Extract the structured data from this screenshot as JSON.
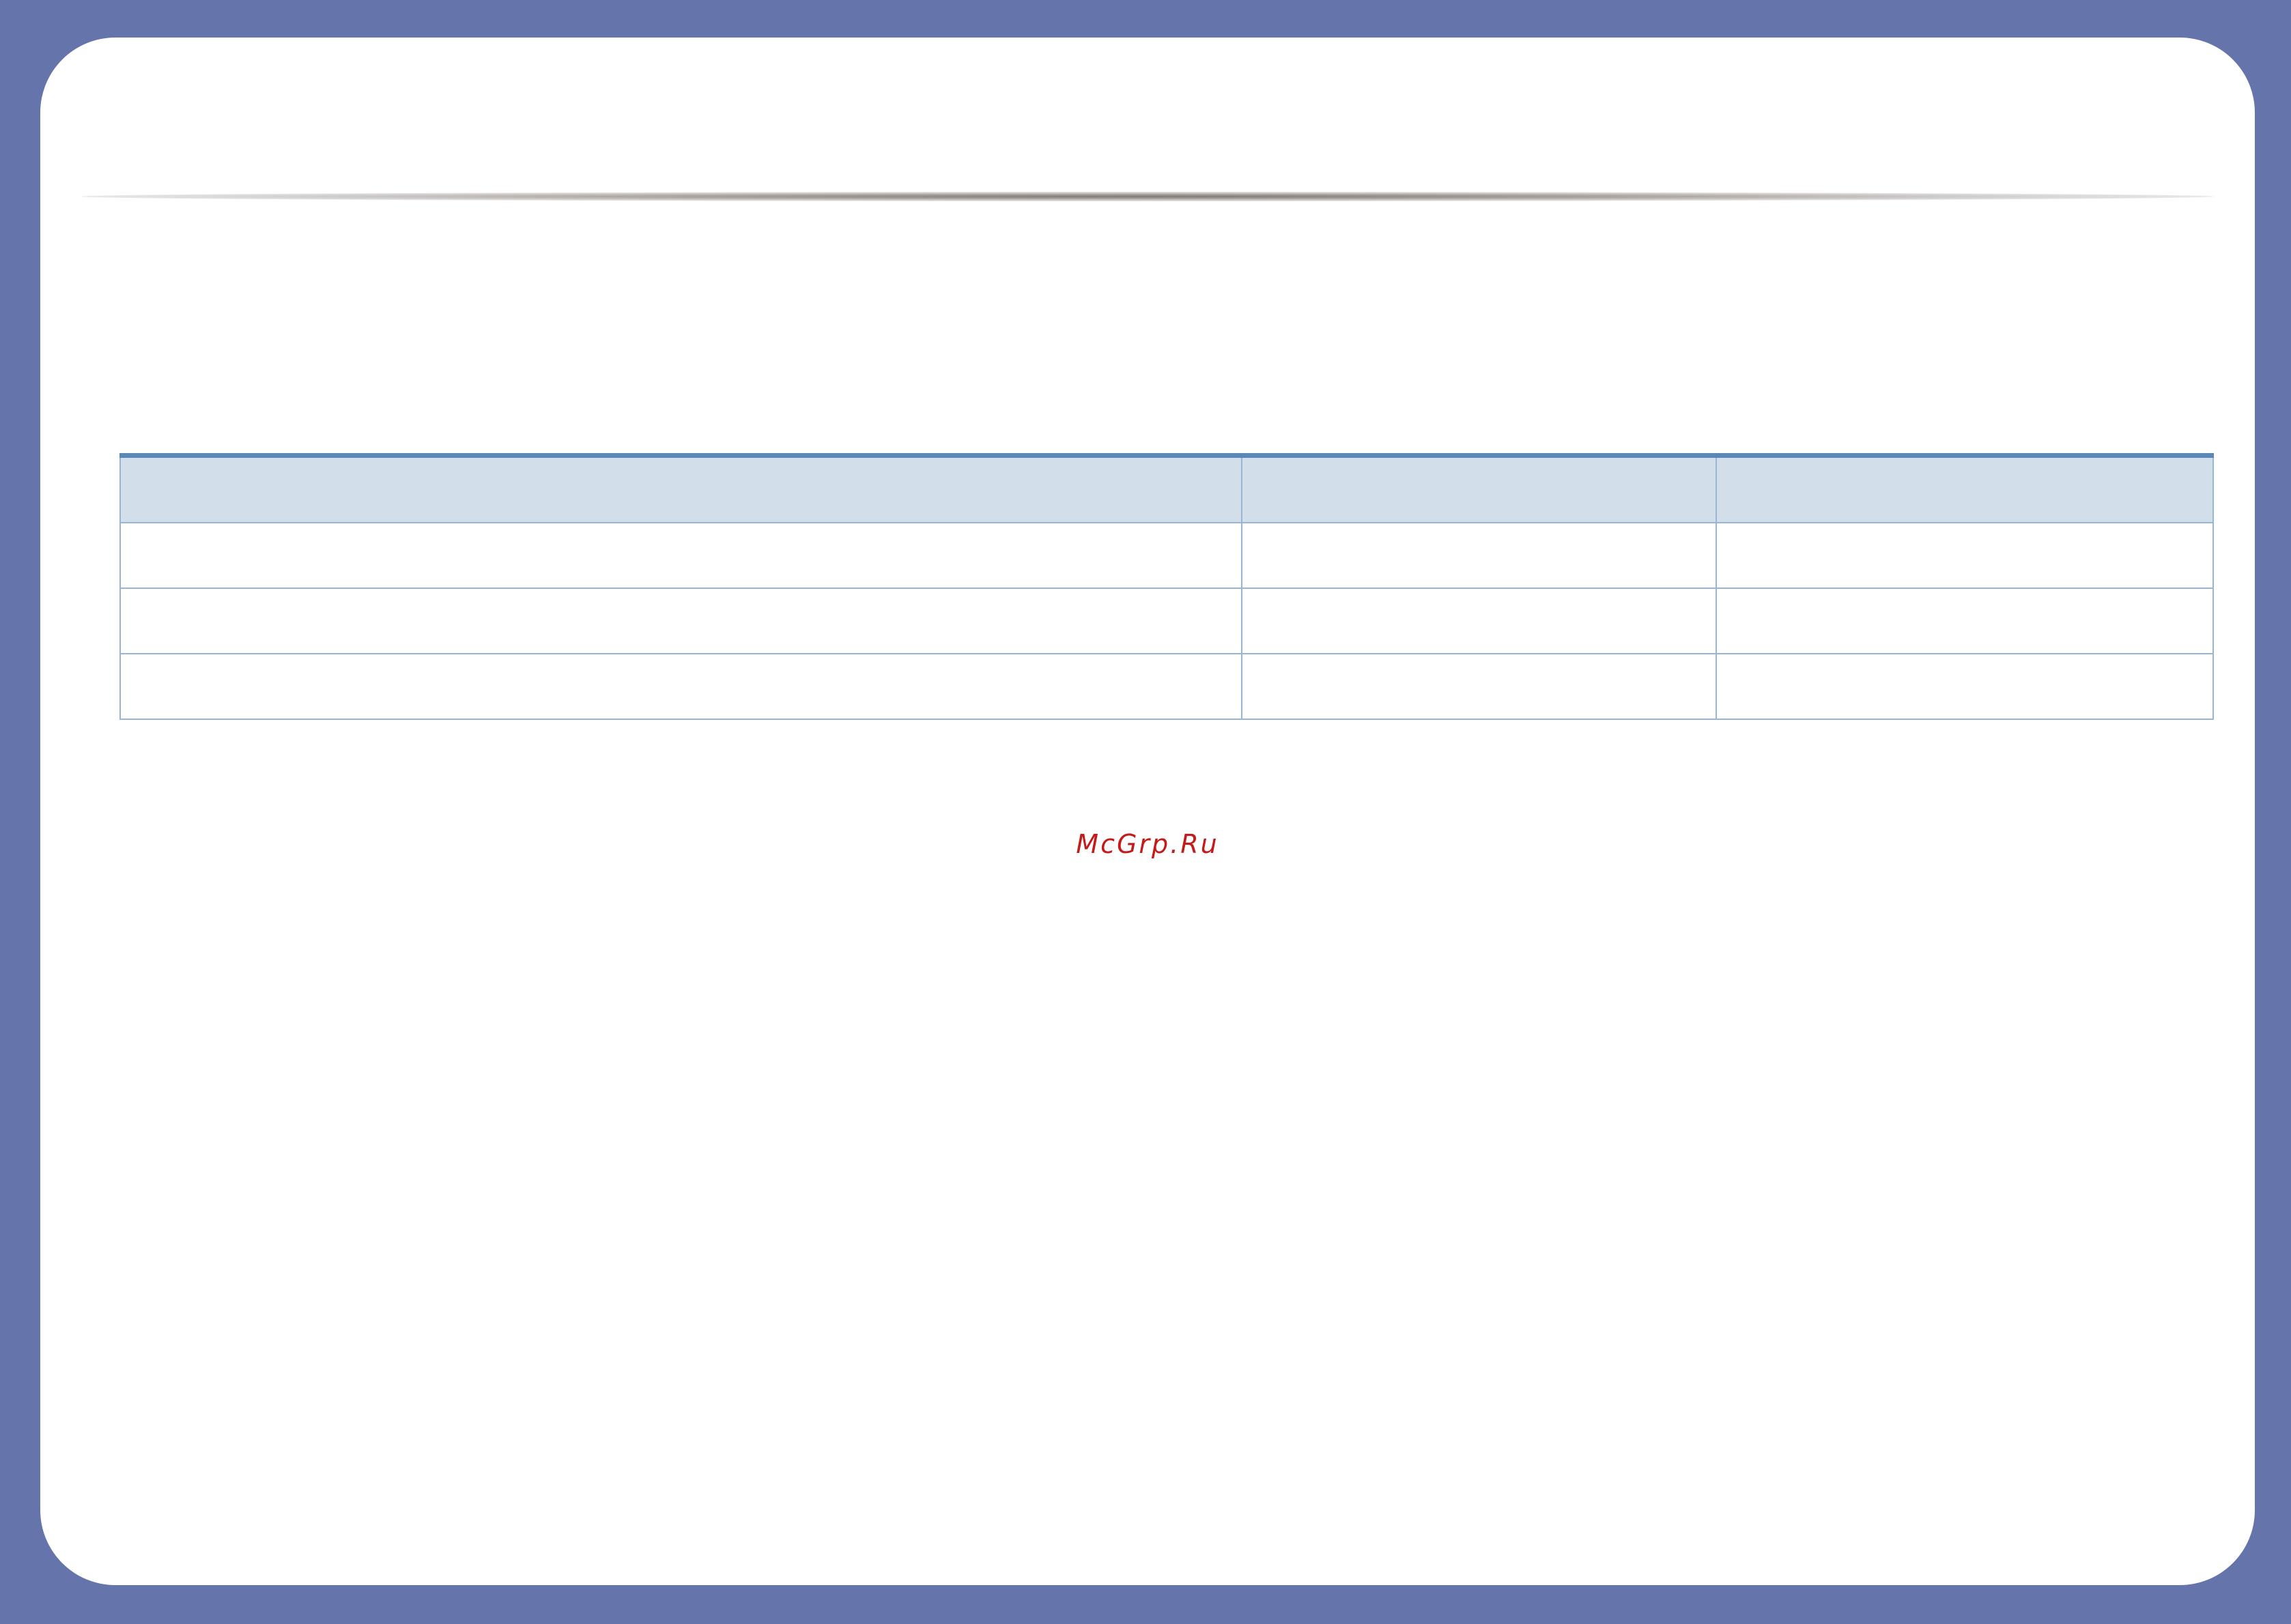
{
  "table": {
    "header": [
      "",
      "",
      ""
    ],
    "rows": [
      [
        "",
        "",
        ""
      ],
      [
        "",
        "",
        ""
      ],
      [
        "",
        "",
        ""
      ]
    ]
  },
  "watermark": {
    "text": "McGrp.Ru",
    "color": "#c41a1a"
  },
  "colors": {
    "background": "#6574aa",
    "page": "#ffffff",
    "table_header_fill": "#d2dee9",
    "table_top_rule": "#5b87b6",
    "table_border": "#97b6d4"
  }
}
